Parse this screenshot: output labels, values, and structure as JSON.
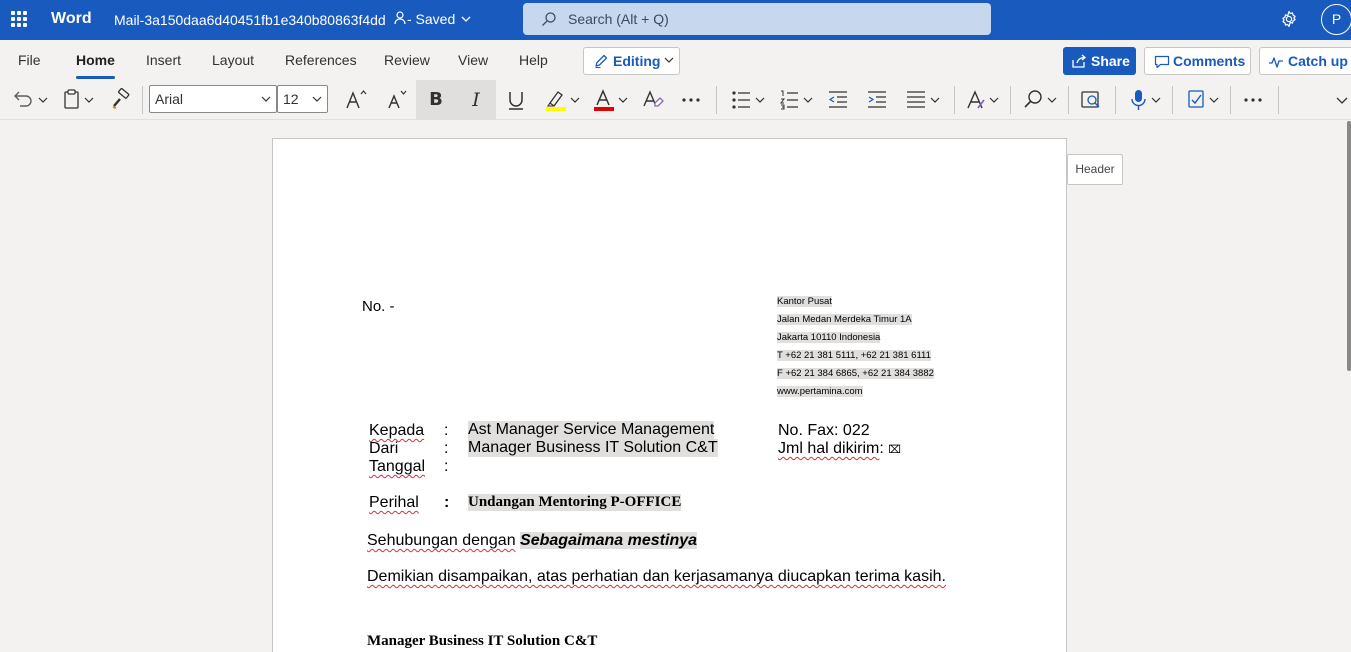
{
  "titlebar": {
    "app_name": "Word",
    "doc_name": "Mail-3a150daa6d40451fb1e340b80863f4dd",
    "saved_status": "- Saved",
    "search_placeholder": "Search (Alt + Q)",
    "avatar_initial": "P",
    "accent_color": "#185abd"
  },
  "ribbon": {
    "tabs": [
      "File",
      "Home",
      "Insert",
      "Layout",
      "References",
      "Review",
      "View",
      "Help"
    ],
    "active_tab": "Home",
    "editing_label": "Editing",
    "share_label": "Share",
    "comments_label": "Comments",
    "catchup_label": "Catch up"
  },
  "toolbar": {
    "font_name": "Arial",
    "font_size": "12",
    "bold_label": "B",
    "italic_label": "I",
    "highlight_color": "#ffff00",
    "font_color": "#e00000"
  },
  "header_tag": "Header",
  "document": {
    "number_line": "No. -",
    "address": [
      "Kantor Pusat",
      "Jalan Medan Merdeka Timur 1A",
      "Jakarta 10110 Indonesia",
      "T +62 21 381 5111, +62 21 381 6111",
      "F +62 21 384 6865, +62 21 384 3882",
      "www.pertamina.com"
    ],
    "kepada_label": "Kepada",
    "kepada_value": "Ast Manager Service Management",
    "dari_label": "Dari",
    "dari_value": "Manager Business IT Solution C&T",
    "tanggal_label": "Tanggal",
    "colon": ":",
    "fax_label": "No. Fax",
    "fax_value": "022",
    "jml_label": "Jml hal dikirim",
    "jml_value": "⌧",
    "perihal_label": "Perihal",
    "perihal_value": "Undangan Mentoring P-OFFICE",
    "body_prefix": "Sehubungan dengan",
    "body_emph": "Sebagaimana mestinya",
    "closing": "Demikian disampaikan, atas perhatian dan kerjasamanya diucapkan terima kasih.",
    "signature": "Manager Business IT Solution C&T"
  }
}
